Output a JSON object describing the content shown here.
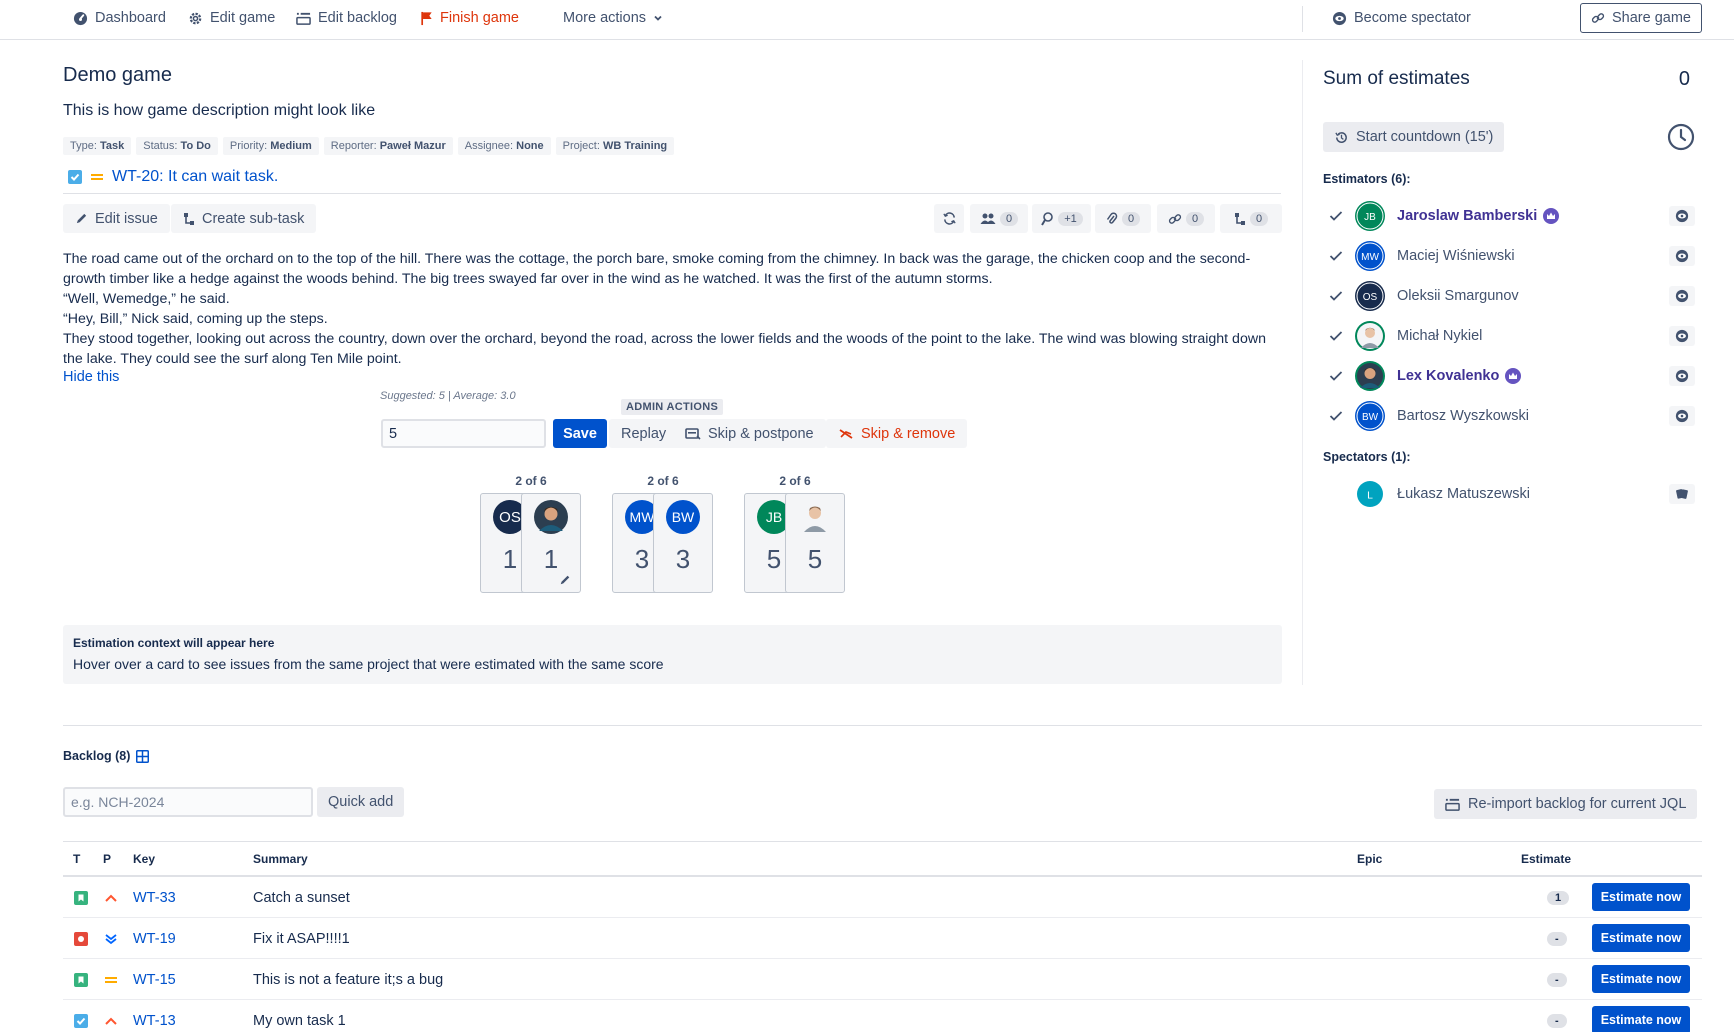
{
  "topbar": {
    "dashboard": "Dashboard",
    "edit_game": "Edit game",
    "edit_backlog": "Edit backlog",
    "finish_game": "Finish game",
    "more_actions": "More actions",
    "become_spectator": "Become spectator",
    "share_game": "Share game"
  },
  "game": {
    "title": "Demo game",
    "description": "This is how game description might look like"
  },
  "issue": {
    "tags": [
      {
        "label": "Type:",
        "value": "Task"
      },
      {
        "label": "Status:",
        "value": "To Do"
      },
      {
        "label": "Priority:",
        "value": "Medium"
      },
      {
        "label": "Reporter:",
        "value": "Paweł Mazur"
      },
      {
        "label": "Assignee:",
        "value": "None"
      },
      {
        "label": "Project:",
        "value": "WB Training"
      }
    ],
    "link": "WT-20: It can wait task.",
    "edit_issue": "Edit issue",
    "create_subtask": "Create sub-task",
    "stats": {
      "watchers": "0",
      "votes": "+1",
      "attachments": "0",
      "links": "0",
      "subtasks": "0"
    },
    "body": [
      "The road came out of the orchard on to the top of the hill. There was the cottage, the porch bare, smoke coming from the chimney. In back was the garage, the chicken coop and the second-growth timber like a hedge against the woods behind. The big trees swayed far over in the wind as he watched. It was the first of the autumn storms.",
      "“Well, Wemedge,” he said.",
      "“Hey, Bill,” Nick said, coming up the steps.",
      "They stood together, looking out across the country, down over the orchard, beyond the road, across the lower fields and the woods of the point to the lake. The wind was blowing straight down the lake. They could see the surf along Ten Mile point."
    ],
    "hide_this": "Hide this"
  },
  "estimation": {
    "suggested": "Suggested: 5 | Average: 3.0",
    "admin_actions": "ADMIN ACTIONS",
    "input_value": "5",
    "save": "Save",
    "replay": "Replay",
    "skip_postpone": "Skip & postpone",
    "skip_remove": "Skip & remove",
    "groups": [
      {
        "label": "2 of 6",
        "cards": [
          {
            "initials": "OS",
            "value": "1",
            "color": "#172b4d"
          },
          {
            "initials": "",
            "value": "1",
            "color": "#2c3e50",
            "photo": true,
            "edit": true
          }
        ]
      },
      {
        "label": "2 of 6",
        "cards": [
          {
            "initials": "MW",
            "value": "3",
            "color": "#0052cc"
          },
          {
            "initials": "BW",
            "value": "3",
            "color": "#0052cc"
          }
        ]
      },
      {
        "label": "2 of 6",
        "cards": [
          {
            "initials": "JB",
            "value": "5",
            "color": "#00875a"
          },
          {
            "initials": "",
            "value": "5",
            "color": "#f4f5f7",
            "photo": true
          }
        ]
      }
    ]
  },
  "context": {
    "title": "Estimation context will appear here",
    "description": "Hover over a card to see issues from the same project that were estimated with the same score"
  },
  "sidebar": {
    "sum_label": "Sum of estimates",
    "sum_value": "0",
    "countdown": "Start countdown (15')",
    "estimators_label": "Estimators (6):",
    "estimators": [
      {
        "name": "Jaroslaw Bamberski",
        "initials": "JB",
        "color": "#00875a",
        "admin": true
      },
      {
        "name": "Maciej Wiśniewski",
        "initials": "MW",
        "color": "#0052cc",
        "admin": false
      },
      {
        "name": "Oleksii Smargunov",
        "initials": "OS",
        "color": "#172b4d",
        "admin": false
      },
      {
        "name": "Michał Nykiel",
        "initials": "",
        "color": "#f4f5f7",
        "admin": false
      },
      {
        "name": "Lex Kovalenko",
        "initials": "",
        "color": "#2c3e50",
        "admin": true
      },
      {
        "name": "Bartosz Wyszkowski",
        "initials": "BW",
        "color": "#0052cc",
        "admin": false
      }
    ],
    "spectators_label": "Spectators (1):",
    "spectators": [
      {
        "name": "Łukasz Matuszewski",
        "initials": "L",
        "color": "#00a3bf"
      }
    ]
  },
  "backlog": {
    "title": "Backlog (8)",
    "quick_add_placeholder": "e.g. NCH-2024",
    "quick_add": "Quick add",
    "reimport": "Re-import backlog for current JQL",
    "columns": {
      "t": "T",
      "p": "P",
      "key": "Key",
      "summary": "Summary",
      "epic": "Epic",
      "estimate": "Estimate"
    },
    "estimate_now": "Estimate now",
    "rows": [
      {
        "type": "story",
        "priority": "high",
        "key": "WT-33",
        "summary": "Catch a sunset",
        "estimate": "1"
      },
      {
        "type": "bug",
        "priority": "lowest",
        "key": "WT-19",
        "summary": "Fix it ASAP!!!!1",
        "estimate": "-"
      },
      {
        "type": "story",
        "priority": "medium",
        "key": "WT-15",
        "summary": "This is not a feature it;s a bug",
        "estimate": "-"
      },
      {
        "type": "task",
        "priority": "high",
        "key": "WT-13",
        "summary": "My own task 1",
        "estimate": "-"
      }
    ]
  },
  "colors": {
    "primary": "#0052cc",
    "danger": "#de350b",
    "admin": "#6554c0"
  }
}
